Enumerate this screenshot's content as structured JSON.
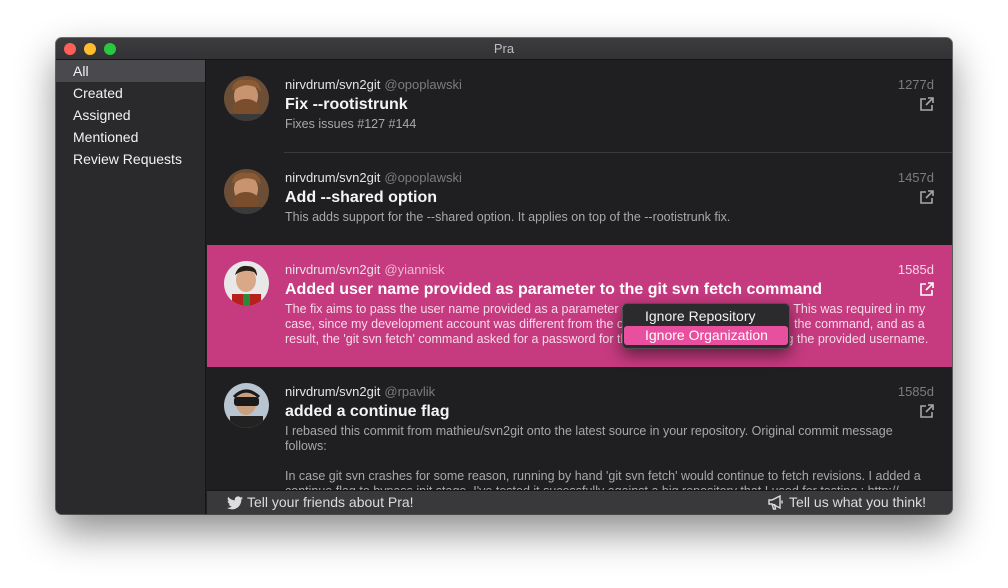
{
  "window": {
    "title": "Pra"
  },
  "sidebar": {
    "items": [
      {
        "label": "All",
        "selected": true
      },
      {
        "label": "Created"
      },
      {
        "label": "Assigned"
      },
      {
        "label": "Mentioned"
      },
      {
        "label": "Review Requests"
      }
    ]
  },
  "pull_requests": [
    {
      "repo": "nirvdrum/svn2git",
      "user": "@opoplawski",
      "age": "1277d",
      "title": "Fix --rootistrunk",
      "description": "Fixes issues #127 #144"
    },
    {
      "repo": "nirvdrum/svn2git",
      "user": "@opoplawski",
      "age": "1457d",
      "title": "Add --shared option",
      "description": "This adds support for the --shared option. It applies on top of the --rootistrunk fix."
    },
    {
      "repo": "nirvdrum/svn2git",
      "user": "@yiannisk",
      "age": "1585d",
      "title": "Added user name provided as parameter to the git svn fetch command",
      "description": "The fix aims to pass the user name provided as a parameter to the 'git svn fetch' command. This was required in my case, since my development account was different from the one provided as a parameter to the command, and as a result, the 'git svn fetch' command asked for a password for the wrong user, instead of using the provided username."
    },
    {
      "repo": "nirvdrum/svn2git",
      "user": "@rpavlik",
      "age": "1585d",
      "title": "added a continue flag",
      "description": "I rebased this commit from mathieu/svn2git onto the latest source in your repository. Original commit message follows:",
      "description2": "In case git svn crashes for some reason, running by hand 'git svn fetch' would continue to fetch revisions. I added a continue flag to bypass init stage. I've tested it sucessfully against a big repository that I used for testing : http://"
    }
  ],
  "context_menu": {
    "items": [
      {
        "label": "Ignore Repository"
      },
      {
        "label": "Ignore Organization",
        "highlighted": true
      }
    ]
  },
  "footer": {
    "left": "Tell your friends about Pra!",
    "right": "Tell us what you think!"
  },
  "colors": {
    "selected_row": "#c63a7f",
    "menu_highlight": "#e94f9f",
    "background": "#1f1f22",
    "sidebar": "#2a2a2d"
  },
  "icons": {
    "external_link": "external-link-icon",
    "twitter": "twitter-icon",
    "megaphone": "megaphone-icon"
  }
}
